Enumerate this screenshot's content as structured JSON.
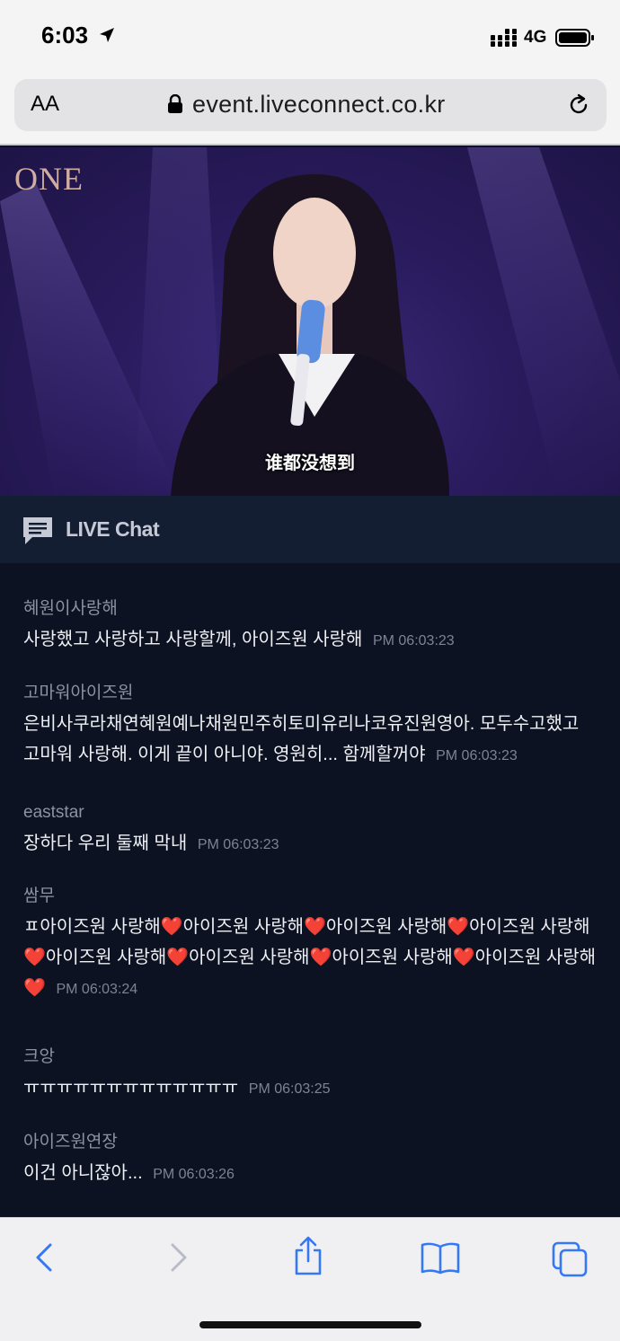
{
  "status_bar": {
    "time": "6:03",
    "network": "4G"
  },
  "browser": {
    "text_size_label": "AA",
    "url": "event.liveconnect.co.kr"
  },
  "video": {
    "logo": "ONE",
    "subtitle": "谁都没想到"
  },
  "chat": {
    "title": "LIVE Chat",
    "messages": [
      {
        "user": "혜원이사랑해",
        "text": "사랑했고 사랑하고 사랑할께, 아이즈원 사랑해",
        "time": "PM 06:03:23"
      },
      {
        "user": "고마워아이즈원",
        "text": "은비사쿠라채연혜원예나채원민주히토미유리나코유진원영아. 모두수고했고 고마워 사랑해. 이게 끝이 아니야. 영원히... 함께할꺼야",
        "time": "PM 06:03:23"
      },
      {
        "user": "eaststar",
        "text": "장하다 우리 둘째 막내",
        "time": "PM 06:03:23"
      },
      {
        "user": "쌈무",
        "text": "ㅍ아이즈원 사랑해❤️아이즈원 사랑해❤️아이즈원 사랑해❤️아이즈원 사랑해❤️아이즈원 사랑해❤️아이즈원 사랑해❤️아이즈원 사랑해❤️아이즈원 사랑해❤️",
        "time": "PM 06:03:24"
      },
      {
        "user": "크앙",
        "text": "ㅠㅠㅠㅠㅠㅠㅠㅠㅠㅠㅠㅠㅠ",
        "time": "PM 06:03:25"
      },
      {
        "user": "아이즈원연장",
        "text": "이건 아니잖아...",
        "time": "PM 06:03:26"
      }
    ]
  },
  "icons": {
    "location": "location-arrow-icon",
    "signal": "signal-bars-icon",
    "battery": "battery-icon",
    "lock": "lock-icon",
    "reload": "reload-icon",
    "chat": "chat-bubble-icon",
    "back": "back-icon",
    "forward": "forward-icon",
    "share": "share-icon",
    "bookmarks": "bookmarks-icon",
    "tabs": "tabs-icon"
  },
  "colors": {
    "accent": "#3478f6",
    "chat_bg": "#0c1221",
    "chat_header_bg": "#141e33"
  }
}
